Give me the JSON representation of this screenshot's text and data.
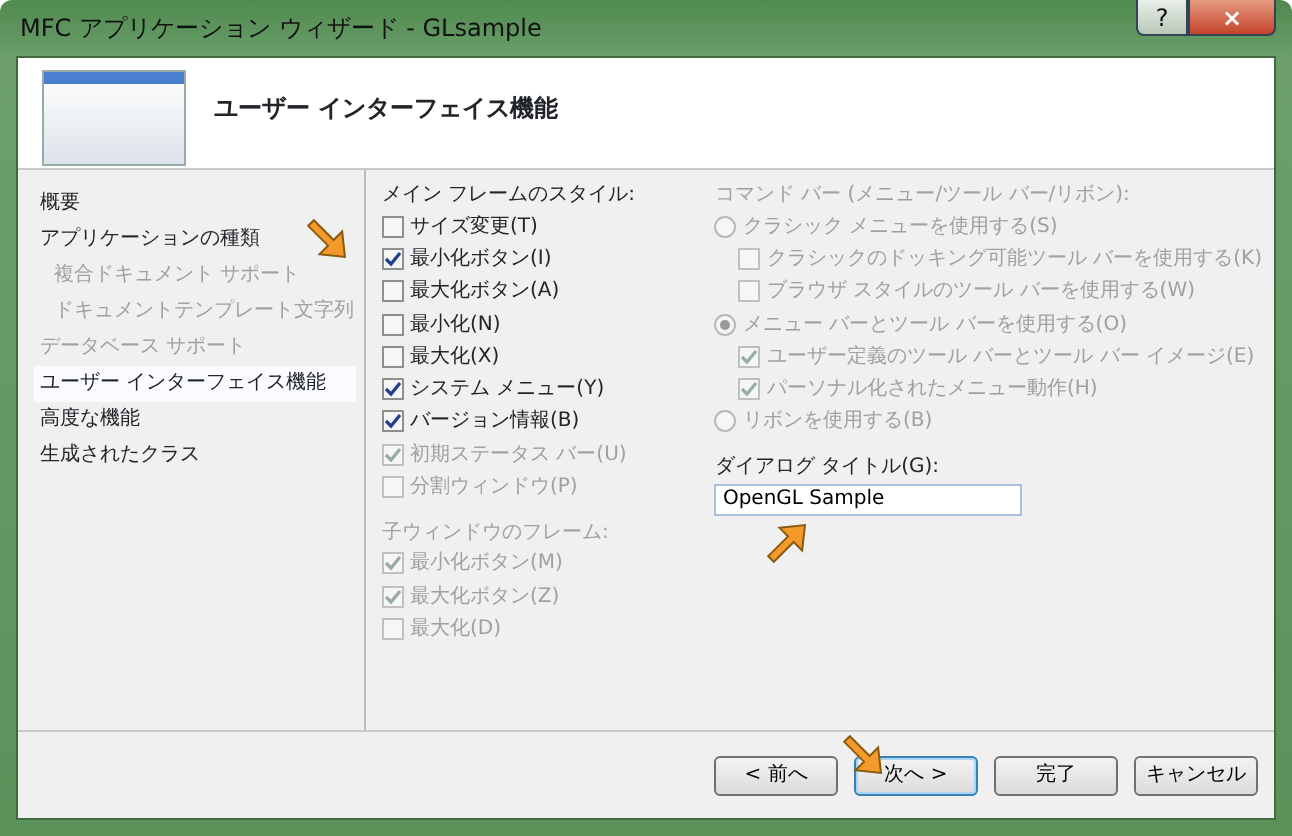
{
  "window": {
    "title": "MFC アプリケーション ウィザード - GLsample",
    "help_button": "?",
    "close_button": "×"
  },
  "header": {
    "title": "ユーザー インターフェイス機能"
  },
  "sidebar": {
    "items": [
      {
        "label": "概要",
        "selected": false,
        "disabled": false
      },
      {
        "label": "アプリケーションの種類",
        "selected": false,
        "disabled": false,
        "children": [
          {
            "label": "複合ドキュメント サポート",
            "selected": false,
            "disabled": true
          },
          {
            "label": "ドキュメントテンプレート文字列",
            "selected": false,
            "disabled": true
          }
        ]
      },
      {
        "label": "データベース サポート",
        "selected": false,
        "disabled": true
      },
      {
        "label": "ユーザー インターフェイス機能",
        "selected": true,
        "disabled": false
      },
      {
        "label": "高度な機能",
        "selected": false,
        "disabled": false
      },
      {
        "label": "生成されたクラス",
        "selected": false,
        "disabled": false
      }
    ]
  },
  "main_frame_styles": {
    "label": "メイン フレームのスタイル:",
    "disabled": false,
    "options": [
      {
        "label": "サイズ変更(T)",
        "checked": false,
        "disabled": false
      },
      {
        "label": "最小化ボタン(I)",
        "checked": true,
        "disabled": false
      },
      {
        "label": "最大化ボタン(A)",
        "checked": false,
        "disabled": false
      },
      {
        "label": "最小化(N)",
        "checked": false,
        "disabled": false
      },
      {
        "label": "最大化(X)",
        "checked": false,
        "disabled": false
      },
      {
        "label": "システム メニュー(Y)",
        "checked": true,
        "disabled": false
      },
      {
        "label": "バージョン情報(B)",
        "checked": true,
        "disabled": false
      },
      {
        "label": "初期ステータス バー(U)",
        "checked": true,
        "disabled": true
      },
      {
        "label": "分割ウィンドウ(P)",
        "checked": false,
        "disabled": true
      }
    ]
  },
  "child_frame_styles": {
    "label": "子ウィンドウのフレーム:",
    "disabled": true,
    "options": [
      {
        "label": "最小化ボタン(M)",
        "checked": true,
        "disabled": true
      },
      {
        "label": "最大化ボタン(Z)",
        "checked": true,
        "disabled": true
      },
      {
        "label": "最大化(D)",
        "checked": false,
        "disabled": true
      }
    ]
  },
  "command_bar": {
    "label": "コマンド バー (メニュー/ツール バー/リボン):",
    "disabled": true,
    "options": [
      {
        "kind": "radio",
        "label": "クラシック メニューを使用する(S)",
        "selected": false,
        "disabled": true,
        "children": [
          {
            "kind": "checkbox",
            "label": "クラシックのドッキング可能ツール バーを使用する(K)",
            "checked": false,
            "disabled": true
          },
          {
            "kind": "checkbox",
            "label": "ブラウザ スタイルのツール バーを使用する(W)",
            "checked": false,
            "disabled": true
          }
        ]
      },
      {
        "kind": "radio",
        "label": "メニュー バーとツール バーを使用する(O)",
        "selected": true,
        "disabled": true,
        "children": [
          {
            "kind": "checkbox",
            "label": "ユーザー定義のツール バーとツール バー イメージ(E)",
            "checked": true,
            "disabled": true
          },
          {
            "kind": "checkbox",
            "label": "パーソナル化されたメニュー動作(H)",
            "checked": true,
            "disabled": true
          }
        ]
      },
      {
        "kind": "radio",
        "label": "リボンを使用する(B)",
        "selected": false,
        "disabled": true
      }
    ]
  },
  "dialog_title": {
    "label": "ダイアログ タイトル(G):",
    "value": "OpenGL Sample"
  },
  "buttons": [
    {
      "label": "< 前へ",
      "default": false
    },
    {
      "label": "次へ >",
      "default": true
    },
    {
      "label": "完了",
      "default": false
    },
    {
      "label": "キャンセル",
      "default": false
    }
  ]
}
